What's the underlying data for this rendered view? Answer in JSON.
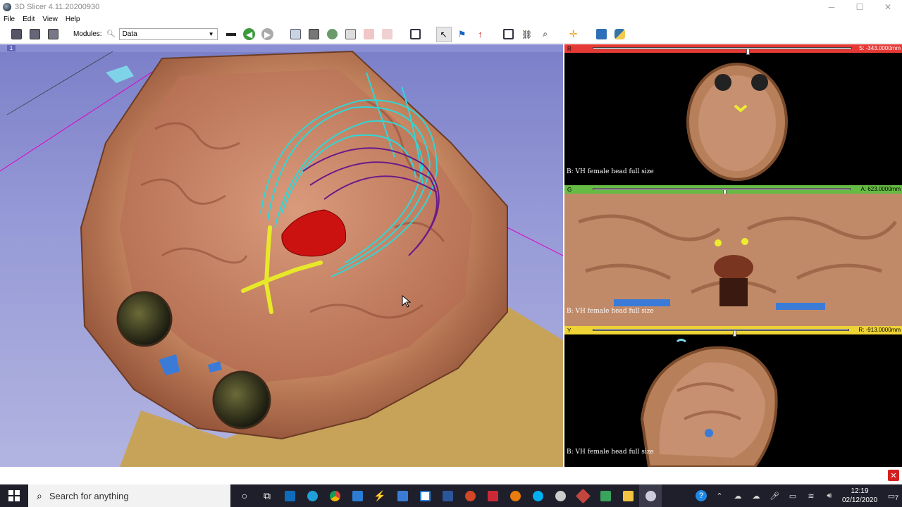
{
  "window": {
    "title": "3D Slicer 4.11.20200930",
    "controls": [
      "─",
      "☐",
      "✕"
    ]
  },
  "menu": [
    "File",
    "Edit",
    "View",
    "Help"
  ],
  "toolbar": {
    "modules_label": "Modules:",
    "module_selected": "Data"
  },
  "view3d": {
    "tag": "1"
  },
  "slices": [
    {
      "letter": "R",
      "value": "S: -343.0000mm",
      "label": "B: VH female head full size",
      "color": "#e53935",
      "slider_position": 0.63
    },
    {
      "letter": "G",
      "value": "A: 623.0000mm",
      "label": "B: VH female head full size",
      "color": "#66bb44",
      "slider_position": 0.51
    },
    {
      "letter": "Y",
      "value": "R: -913.0000mm",
      "label": "B: VH female head full size",
      "color": "#eed336",
      "slider_position": 0.55
    }
  ],
  "taskbar": {
    "search_placeholder": "Search for anything",
    "time": "12:19",
    "date": "02/12/2020",
    "notification_count": "7"
  }
}
